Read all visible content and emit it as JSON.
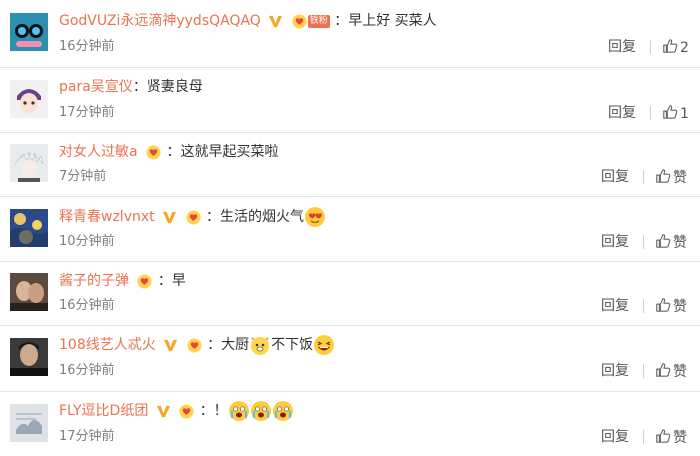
{
  "comments": [
    {
      "user": "GodVUZi永远滴神yydsQAQAQ",
      "text": "：早上好 买菜人",
      "time": "16分钟前",
      "reply": "回复",
      "likes": "2",
      "fan_badge": "铁粉"
    },
    {
      "user": "para吴宣仪",
      "text": "：贤妻良母",
      "time": "17分钟前",
      "reply": "回复",
      "likes": "1"
    },
    {
      "user": "对女人过敏a",
      "text": "：这就早起买菜啦",
      "time": "7分钟前",
      "reply": "回复",
      "likes": "赞"
    },
    {
      "user": "释青春wzlvnxt",
      "text": "：生活的烟火气",
      "time": "10分钟前",
      "reply": "回复",
      "likes": "赞"
    },
    {
      "user": "酱子的子弹",
      "text": "：早",
      "time": "16分钟前",
      "reply": "回复",
      "likes": "赞"
    },
    {
      "user": "108线艺人忒火",
      "text": "：大厨",
      "text2": "不下饭",
      "time": "16分钟前",
      "reply": "回复",
      "likes": "赞"
    },
    {
      "user": "FLY逗比D纸团",
      "text": "：！",
      "time": "17分钟前",
      "reply": "回复",
      "likes": "赞"
    }
  ],
  "colors": {
    "name": "#eb7350",
    "vip": "#f5a623",
    "time": "#808080"
  }
}
